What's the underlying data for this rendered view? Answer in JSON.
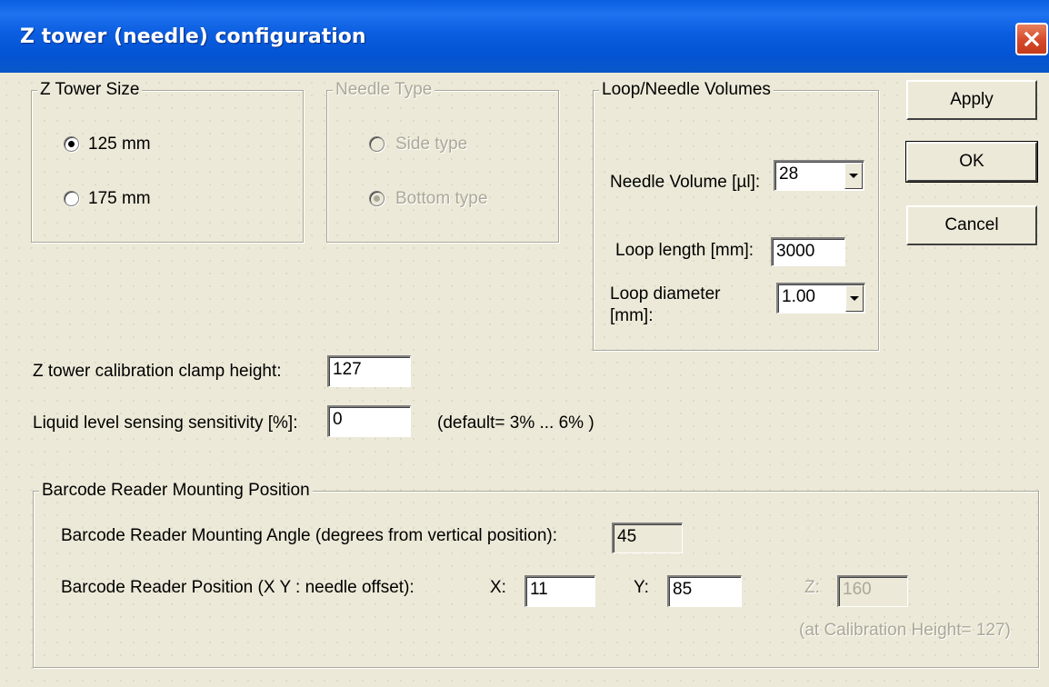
{
  "window": {
    "title": "Z tower (needle) configuration"
  },
  "z_tower_size": {
    "label": "Z Tower Size",
    "options": [
      {
        "label": "125 mm",
        "checked": true
      },
      {
        "label": "175 mm",
        "checked": false
      }
    ]
  },
  "needle_type": {
    "label": "Needle Type",
    "enabled": false,
    "options": [
      {
        "label": "Side type",
        "checked": false
      },
      {
        "label": "Bottom type",
        "checked": true
      }
    ]
  },
  "volumes": {
    "label": "Loop/Needle Volumes",
    "needle_volume_label": "Needle Volume [µl]:",
    "needle_volume_value": "28",
    "loop_length_label": "Loop length [mm]:",
    "loop_length_value": "3000",
    "loop_diameter_label": "Loop diameter [mm]:",
    "loop_diameter_value": "1.00"
  },
  "buttons": {
    "apply": "Apply",
    "ok": "OK",
    "cancel": "Cancel"
  },
  "clamp": {
    "label": "Z tower calibration clamp height:",
    "value": "127"
  },
  "sensitivity": {
    "label": "Liquid level sensing sensitivity [%]:",
    "value": "0",
    "hint": "(default= 3% ... 6% )"
  },
  "barcode": {
    "label": "Barcode Reader Mounting Position",
    "angle_label": "Barcode Reader Mounting Angle (degrees from vertical position):",
    "angle_value": "45",
    "position_label": "Barcode Reader Position (X Y : needle offset):",
    "x_label": "X:",
    "x_value": "11",
    "y_label": "Y:",
    "y_value": "85",
    "z_label": "Z:",
    "z_value": "160",
    "z_note": "(at Calibration Height= 127)"
  },
  "icons": {
    "close": "close-icon"
  },
  "colors": {
    "title_bar": "#0a5fe0",
    "close_button": "#d5492a",
    "background": "#ece9d8"
  }
}
